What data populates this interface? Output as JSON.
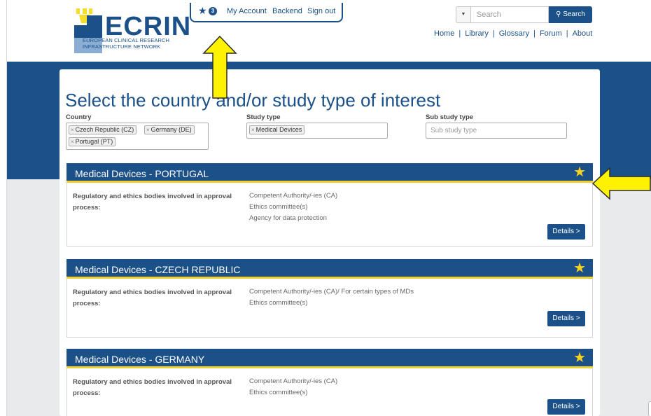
{
  "logo": {
    "wordmark": "ECRIN",
    "subtitle_line1": "EUROPEAN CLINICAL RESEARCH",
    "subtitle_line2": "INFRASTRUCTURE NETWORK"
  },
  "user_bar": {
    "favorites_count": "3",
    "my_account": "My Account",
    "backend": "Backend",
    "sign_out": "Sign out"
  },
  "search": {
    "placeholder": "Search",
    "button_label": "Search"
  },
  "nav": {
    "items": [
      "Home",
      "Library",
      "Glossary",
      "Forum",
      "About"
    ]
  },
  "page": {
    "title": "Select the country and/or study type of interest"
  },
  "filters": {
    "country_label": "Country",
    "countries": [
      "Czech Republic (CZ)",
      "Germany (DE)",
      "Portugal (PT)"
    ],
    "study_type_label": "Study type",
    "study_types": [
      "Medical Devices"
    ],
    "sub_study_type_label": "Sub study type",
    "sub_study_type_placeholder": "Sub study type"
  },
  "results": [
    {
      "title": "Medical Devices - PORTUGAL",
      "label": "Regulatory and ethics bodies involved in approval process:",
      "values": [
        "Competent Authority/-ies (CA)",
        "Ethics committee(s)",
        "Agency for data protection"
      ],
      "details": "Details >"
    },
    {
      "title": "Medical Devices - CZECH REPUBLIC",
      "label": "Regulatory and ethics bodies involved in approval process:",
      "values": [
        "Competent Authority/-ies (CA)/ For certain types of MDs",
        "Ethics committee(s)"
      ],
      "details": "Details >"
    },
    {
      "title": "Medical Devices - GERMANY",
      "label": "Regulatory and ethics bodies involved in approval process:",
      "values": [
        "Competent Authority/-ies (CA)",
        "Ethics committee(s)"
      ],
      "details": "Details >"
    }
  ],
  "colors": {
    "brand_blue": "#1b5188",
    "accent_yellow": "#f2d02a",
    "arrow_yellow": "#fff200"
  }
}
